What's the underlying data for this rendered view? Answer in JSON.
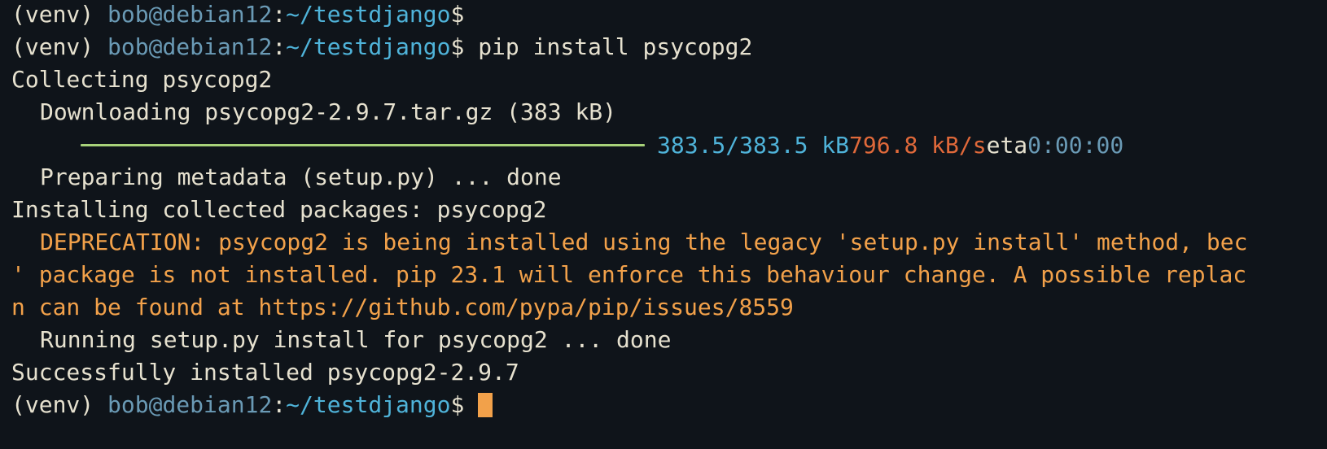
{
  "window": {
    "title": ""
  },
  "prompt": {
    "venv": "(venv) ",
    "user_host": "bob@debian12",
    "sep": ":",
    "path": "~/testdjango",
    "symbol": "$ "
  },
  "commands": {
    "first": "",
    "second": "pip install psycopg2"
  },
  "output": {
    "collecting": "Collecting psycopg2",
    "downloading": "Downloading psycopg2-2.9.7.tar.gz (383 kB)",
    "progress": {
      "fraction": 1.0,
      "size": "383.5/383.5 kB",
      "speed": "796.8 kB/s",
      "eta_label": "eta",
      "eta": "0:00:00"
    },
    "preparing": "Preparing metadata (setup.py) ... done",
    "installing": "Installing collected packages: psycopg2",
    "deprecation_1": "DEPRECATION: psycopg2 is being installed using the legacy 'setup.py install' method, bec",
    "deprecation_2": "' package is not installed. pip 23.1 will enforce this behaviour change. A possible replac",
    "deprecation_3": "n can be found at https://github.com/pypa/pip/issues/8559",
    "running": "Running setup.py install for psycopg2 ... done",
    "success": "Successfully installed psycopg2-2.9.7"
  },
  "colors": {
    "background": "#0f141a",
    "foreground": "#e6e1cf",
    "user_host": "#6a9ab5",
    "path": "#4fb3d9",
    "warning": "#f2a14a",
    "speed": "#e0693a",
    "progress_bar": "#a8d27a",
    "cursor": "#f2a14a"
  }
}
